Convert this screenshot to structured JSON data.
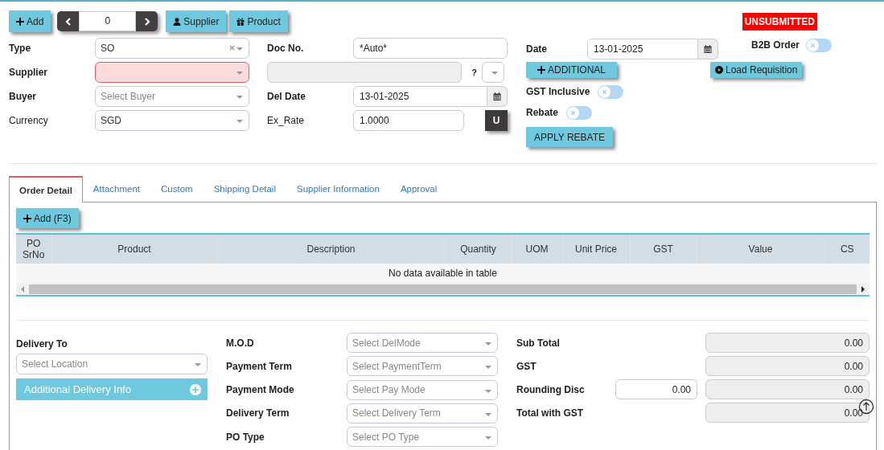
{
  "toolbar": {
    "add_button": "Add",
    "pager_value": "0",
    "buttons": [
      {
        "label": "Supplier",
        "kind": "user"
      },
      {
        "label": "Product",
        "kind": "gift"
      }
    ]
  },
  "status_badge": "UNSUBMITTED",
  "header_left": [
    {
      "label": "Type",
      "required": true,
      "value": "SO",
      "clearable": true,
      "invalid": false
    },
    {
      "label": "Supplier",
      "required": true,
      "clearable": false,
      "invalid": true
    },
    {
      "label": "Buyer",
      "required": true,
      "placeholder": "Select Buyer",
      "clearable": false,
      "invalid": false
    },
    {
      "label": "Currency",
      "required": false,
      "value": "SGD",
      "clearable": false,
      "invalid": false
    }
  ],
  "header_middle": [
    {
      "kind": "text",
      "label": "Doc No.",
      "required": true,
      "value": "*Auto*"
    },
    {
      "kind": "lookup",
      "disabled": true,
      "hint": "?"
    },
    {
      "kind": "date",
      "label": "Del Date",
      "required": true,
      "value": "13-01-2025"
    },
    {
      "kind": "rate",
      "label": "Ex_Rate",
      "required": false,
      "value": "1.0000",
      "button": "U"
    }
  ],
  "header_right": {
    "date": {
      "label": "Date",
      "value": "13-01-2025"
    },
    "b2b": {
      "label": "B2B Order",
      "on": false
    },
    "additional_button": "ADDITIONAL",
    "load_requisition_button": "Load Requisition",
    "switches": [
      {
        "label": "GST Inclusive",
        "on": false
      },
      {
        "label": "Rebate",
        "on": false
      }
    ],
    "apply_rebate_button": "APPLY REBATE"
  },
  "tabs": [
    {
      "label": "Order Detail",
      "selected": true
    },
    {
      "label": "Attachment",
      "selected": false
    },
    {
      "label": "Custom",
      "selected": false
    },
    {
      "label": "Shipping Detail",
      "selected": false
    },
    {
      "label": "Supplier Information",
      "selected": false
    },
    {
      "label": "Approval",
      "selected": false
    }
  ],
  "add_line_button": "Add (F3)",
  "table": {
    "columns": [
      "PO SrNo",
      "Product",
      "Description",
      "Quantity",
      "UOM",
      "Unit Price",
      "GST",
      "Value",
      "CS"
    ],
    "empty_message": "No data available in table"
  },
  "delivery": {
    "label": "Delivery To",
    "placeholder": "Select Location",
    "info_bar": "Additional Delivery Info"
  },
  "terms": [
    {
      "label": "M.O.D",
      "placeholder": "Select DelMode"
    },
    {
      "label": "Payment Term",
      "placeholder": "Select PaymentTerm"
    },
    {
      "label": "Payment Mode",
      "placeholder": "Select Pay Mode"
    },
    {
      "label": "Delivery Term",
      "placeholder": "Select Delivery Term"
    },
    {
      "label": "PO Type",
      "placeholder": "Select PO Type"
    }
  ],
  "totals": [
    {
      "label": "Sub Total",
      "value": "0.00"
    },
    {
      "label": "GST",
      "value": "0.00"
    },
    {
      "label": "Rounding Disc",
      "input": "0.00",
      "value": "0.00"
    },
    {
      "label": "Total with GST",
      "value": "0.00"
    }
  ]
}
